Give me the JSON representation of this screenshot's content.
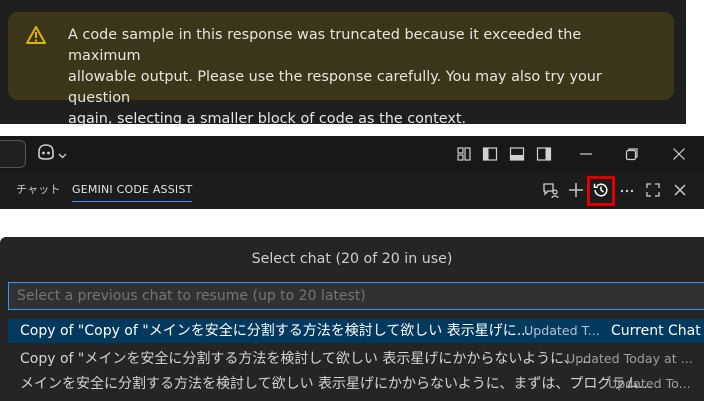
{
  "warning": {
    "icon": "warning-icon",
    "line1": "A code sample in this response was truncated because it exceeded the maximum",
    "line2": "allowable output. Please use the response carefully. You may also try your question",
    "line3": "again, selecting a smaller block of code as the context.",
    "icon_color": "#e0b400"
  },
  "titlebar": {
    "tabs": [
      {
        "label": "チャット"
      },
      {
        "label": "GEMINI CODE ASSIST"
      }
    ],
    "active_tab": "GEMINI CODE ASSIST",
    "layout_icons": [
      "layout-panels-icon",
      "toggle-primary-sidebar-icon",
      "toggle-panel-icon",
      "toggle-secondary-sidebar-icon"
    ],
    "window_controls": [
      "minimize-icon",
      "restore-icon",
      "close-icon"
    ],
    "actions": [
      "chat-feedback-icon",
      "new-chat-icon",
      "history-icon",
      "more-icon",
      "maximize-icon",
      "close-icon"
    ],
    "highlight_color": "#e00000"
  },
  "select_chat": {
    "title": "Select chat (20 of 20 in use)",
    "placeholder": "Select a previous chat to resume (up to 20 latest)",
    "items": [
      {
        "label": "Copy of \"Copy of \"メインを安全に分割する方法を検討して欲しい 表示星げに...",
        "meta": "Updated T...",
        "badge": "Current Chat"
      },
      {
        "label": "Copy of \"メインを安全に分割する方法を検討して欲しい 表示星げにかからないように、...",
        "meta": "Updated Today at ..."
      },
      {
        "label": "メインを安全に分割する方法を検討して欲しい 表示星げにかからないように、まずは、プログラム...",
        "meta": "Updated To..."
      }
    ]
  }
}
